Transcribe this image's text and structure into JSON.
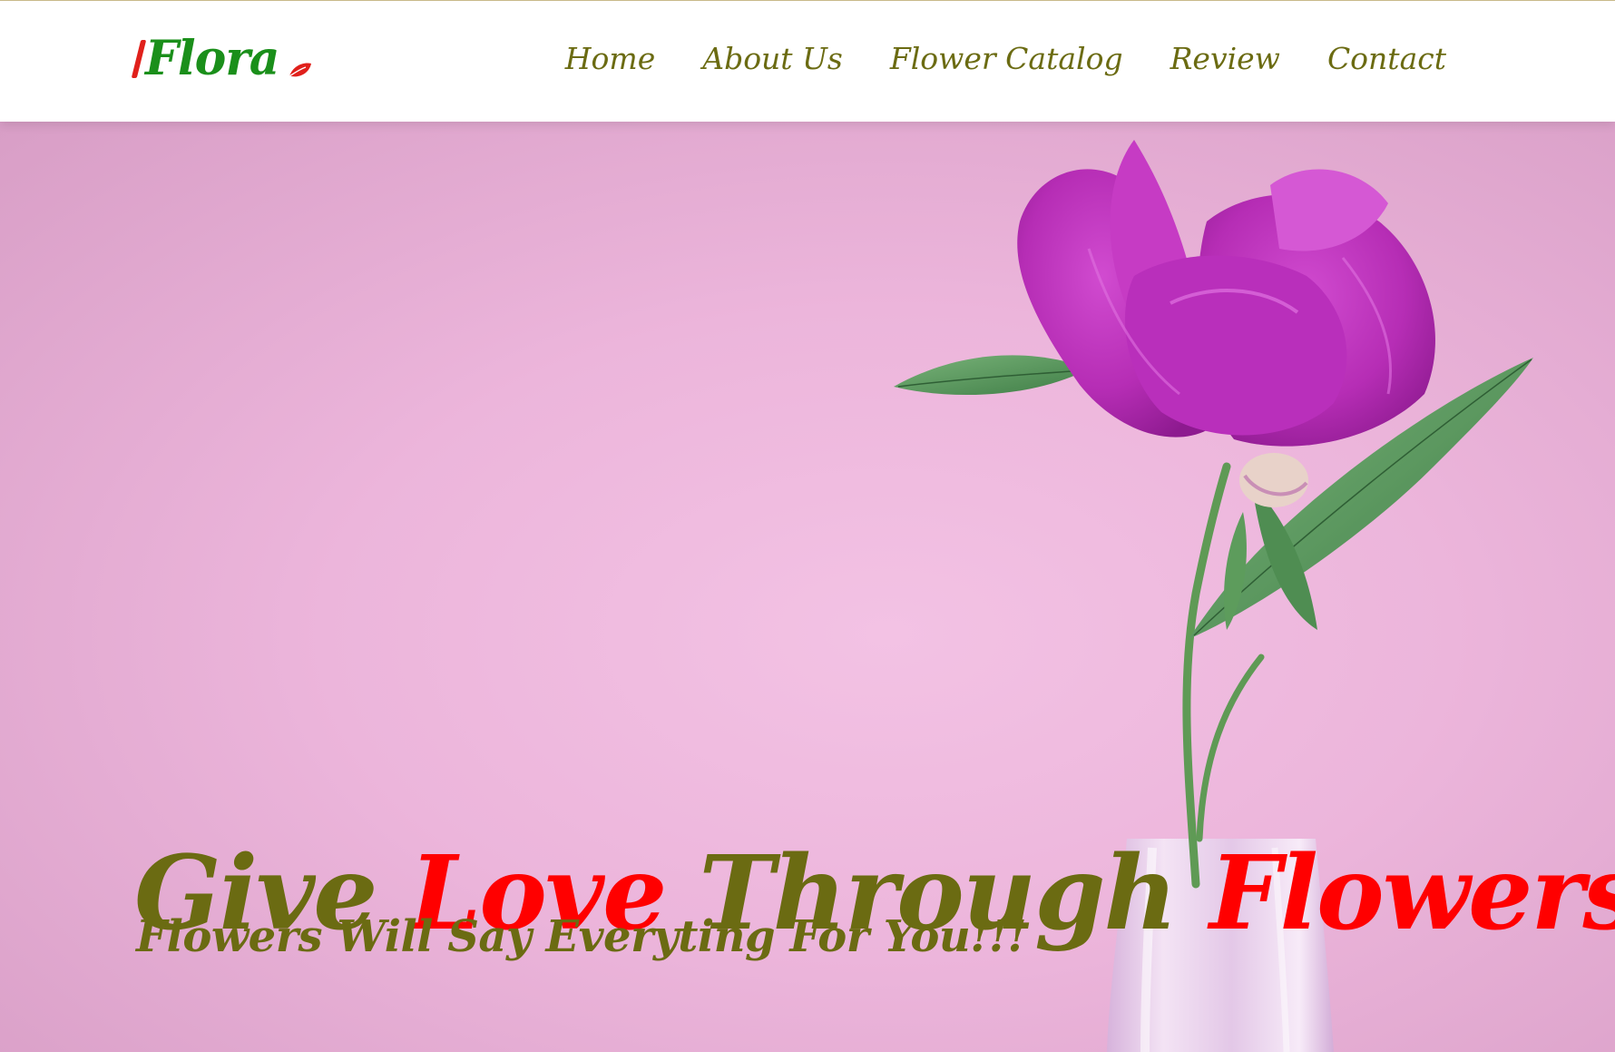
{
  "brand": {
    "name": "Flora",
    "accent_red": "#e0201b",
    "accent_green": "#1a8f1a"
  },
  "nav": {
    "items": [
      {
        "label": "Home"
      },
      {
        "label": "About Us"
      },
      {
        "label": "Flower Catalog"
      },
      {
        "label": "Review"
      },
      {
        "label": "Contact"
      }
    ],
    "color": "#6b6b12"
  },
  "hero": {
    "headline": {
      "word1": "Give",
      "word2": "Love",
      "word3": "Through",
      "word4": "Flowers!"
    },
    "subheadline": "Flowers Will Say Everyting For You!!!",
    "image": "pink-peony-in-vase",
    "background_color": "#f0bde2",
    "olive_color": "#6b6b12",
    "red_color": "#ff0000"
  }
}
